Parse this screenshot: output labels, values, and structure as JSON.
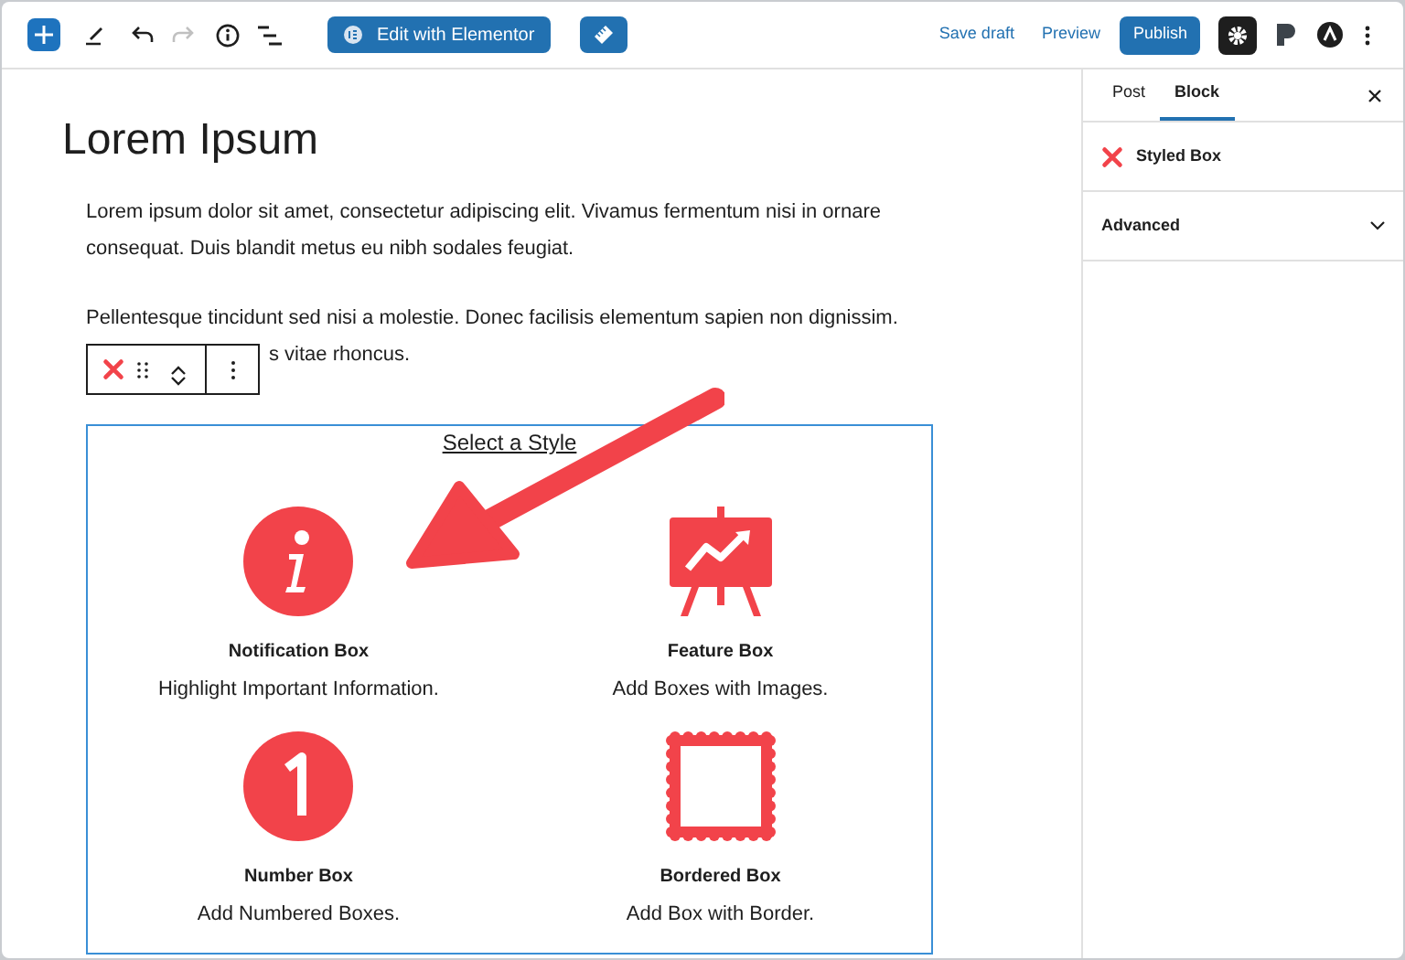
{
  "toolbar": {
    "elementor_button": "Edit with Elementor",
    "save_draft": "Save draft",
    "preview": "Preview",
    "publish": "Publish",
    "settings_active": true
  },
  "post": {
    "title": "Lorem Ipsum",
    "paragraphs": [
      {
        "lines": [
          "Lorem ipsum dolor sit amet, consectetur adipiscing elit. Vivamus fermentum nisi in ornare",
          "consequat. Duis blandit metus eu nibh sodales feugiat."
        ]
      },
      {
        "lines": [
          "Pellentesque tincidunt sed nisi a molestie. Donec facilisis elementum sapien non dignissim.",
          "s vitae rhoncus."
        ]
      }
    ]
  },
  "styled_box": {
    "heading": "Select a Style",
    "styles": [
      {
        "kind": "info",
        "title": "Notification Box",
        "description": "Highlight Important Information."
      },
      {
        "kind": "feature",
        "title": "Feature Box",
        "description": "Add Boxes with Images."
      },
      {
        "kind": "number",
        "title": "Number Box",
        "description": "Add Numbered Boxes."
      },
      {
        "kind": "bordered",
        "title": "Bordered Box",
        "description": "Add Box with Border."
      }
    ]
  },
  "sidebar": {
    "tabs": [
      {
        "label": "Post",
        "selected": false
      },
      {
        "label": "Block",
        "selected": true
      }
    ],
    "block_name": "Styled Box",
    "panels": [
      {
        "label": "Advanced",
        "expanded": false
      }
    ]
  }
}
